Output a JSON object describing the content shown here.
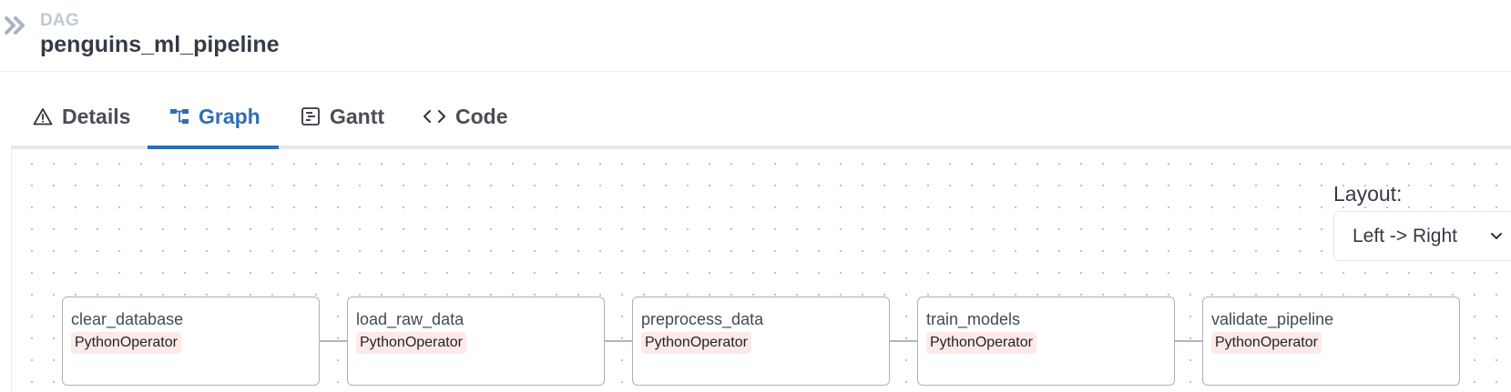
{
  "header": {
    "kind_label": "DAG",
    "dag_id": "penguins_ml_pipeline"
  },
  "tabs": [
    {
      "label": "Details",
      "icon": "warning-triangle-icon",
      "active": false
    },
    {
      "label": "Graph",
      "icon": "graph-icon",
      "active": true
    },
    {
      "label": "Gantt",
      "icon": "gantt-icon",
      "active": false
    },
    {
      "label": "Code",
      "icon": "code-icon",
      "active": false
    }
  ],
  "layout_control": {
    "label": "Layout:",
    "selected": "Left -> Right"
  },
  "graph": {
    "nodes": [
      {
        "task_id": "clear_database",
        "operator": "PythonOperator"
      },
      {
        "task_id": "load_raw_data",
        "operator": "PythonOperator"
      },
      {
        "task_id": "preprocess_data",
        "operator": "PythonOperator"
      },
      {
        "task_id": "train_models",
        "operator": "PythonOperator"
      },
      {
        "task_id": "validate_pipeline",
        "operator": "PythonOperator"
      }
    ]
  },
  "colors": {
    "accent": "#2d6eb5",
    "operator_badge": "#fde9e7",
    "edge": "#a9b6c6"
  }
}
